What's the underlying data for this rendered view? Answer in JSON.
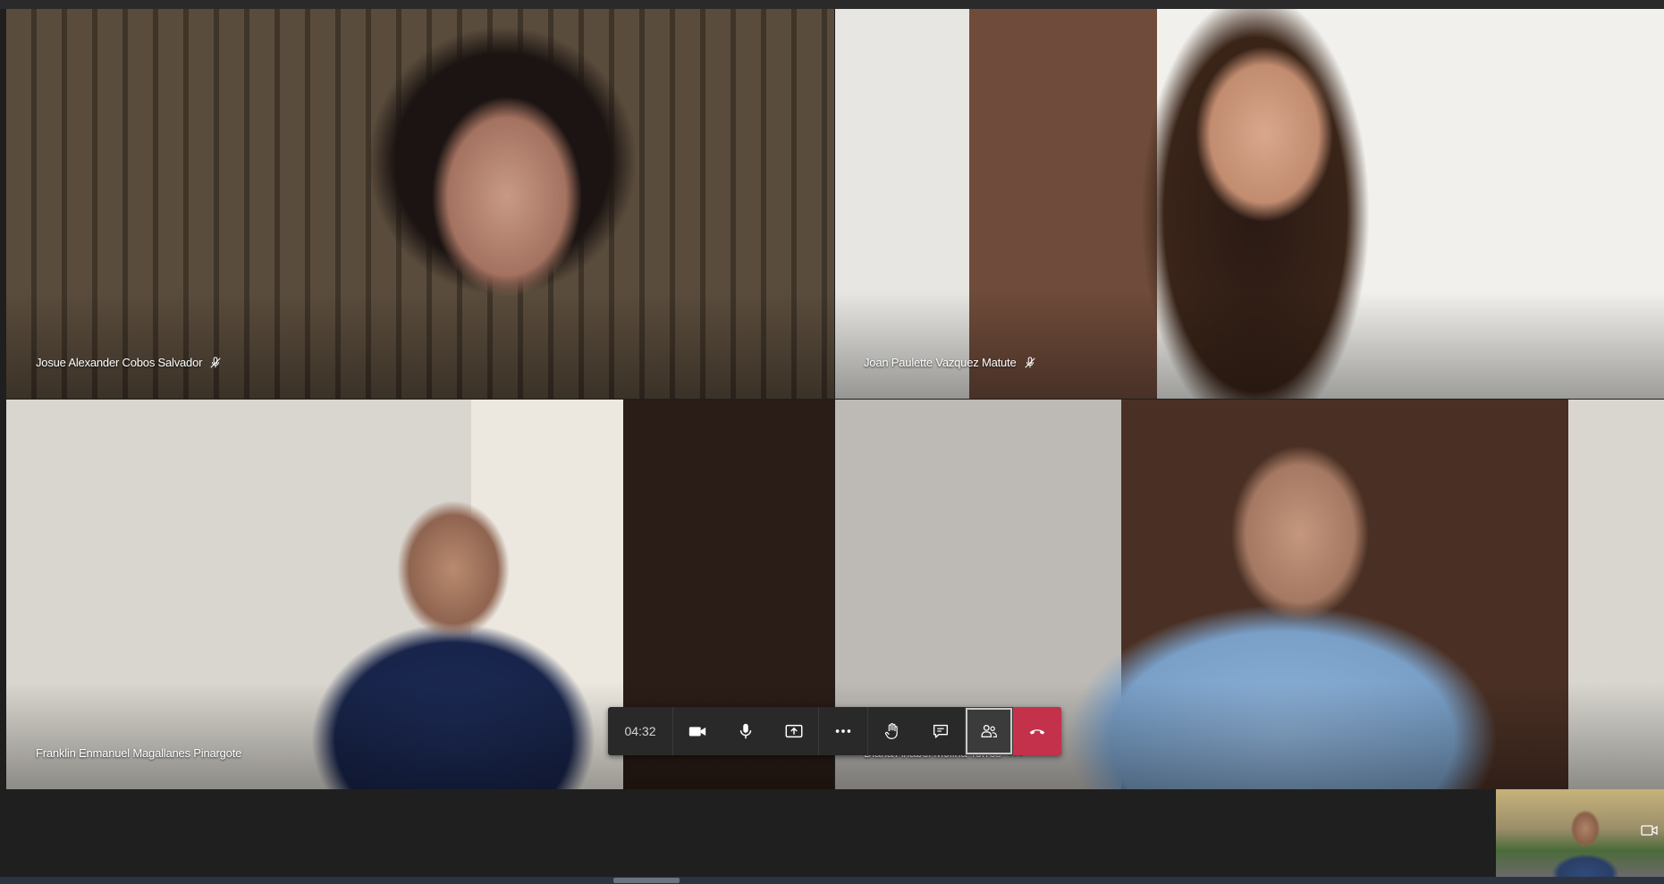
{
  "call": {
    "timer": "04:32"
  },
  "participants": [
    {
      "name": "Josue Alexander Cobos Salvador",
      "muted": true
    },
    {
      "name": "Joan Paulette Vazquez Matute",
      "muted": true
    },
    {
      "name": "Franklin Enmanuel Magallanes Pinargote",
      "muted": false
    },
    {
      "name": "Diana Anabel Molina Torres",
      "more_options": "•••"
    }
  ],
  "controls": [
    {
      "icon": "camera-icon"
    },
    {
      "icon": "microphone-icon"
    },
    {
      "icon": "share-screen-icon"
    },
    {
      "icon": "more-actions-icon"
    },
    {
      "icon": "raise-hand-icon"
    },
    {
      "icon": "chat-icon"
    },
    {
      "icon": "participants-icon",
      "active": true
    },
    {
      "icon": "hang-up-icon"
    }
  ],
  "colors": {
    "background": "#1f1f1f",
    "controls_bg": "#292929",
    "hangup": "#c4314b"
  }
}
